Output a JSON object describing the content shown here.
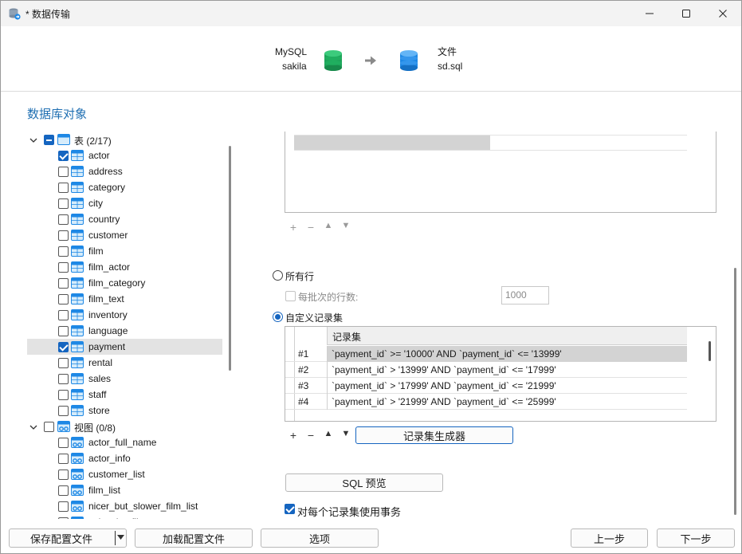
{
  "window": {
    "title": "* 数据传输",
    "controls": [
      "minimize-icon",
      "maximize-icon",
      "close-icon"
    ]
  },
  "header": {
    "source_type": "MySQL",
    "source_name": "sakila",
    "target_type": "文件",
    "target_name": "sd.sql"
  },
  "section_title": "数据库对象",
  "tree": {
    "tables_group": {
      "label": "表",
      "count": "(2/17)"
    },
    "tables": [
      {
        "label": "actor",
        "checked": true,
        "selected": false
      },
      {
        "label": "address",
        "checked": false,
        "selected": false
      },
      {
        "label": "category",
        "checked": false,
        "selected": false
      },
      {
        "label": "city",
        "checked": false,
        "selected": false
      },
      {
        "label": "country",
        "checked": false,
        "selected": false
      },
      {
        "label": "customer",
        "checked": false,
        "selected": false
      },
      {
        "label": "film",
        "checked": false,
        "selected": false
      },
      {
        "label": "film_actor",
        "checked": false,
        "selected": false
      },
      {
        "label": "film_category",
        "checked": false,
        "selected": false
      },
      {
        "label": "film_text",
        "checked": false,
        "selected": false
      },
      {
        "label": "inventory",
        "checked": false,
        "selected": false
      },
      {
        "label": "language",
        "checked": false,
        "selected": false
      },
      {
        "label": "payment",
        "checked": true,
        "selected": true
      },
      {
        "label": "rental",
        "checked": false,
        "selected": false
      },
      {
        "label": "sales",
        "checked": false,
        "selected": false
      },
      {
        "label": "staff",
        "checked": false,
        "selected": false
      },
      {
        "label": "store",
        "checked": false,
        "selected": false
      }
    ],
    "views_group": {
      "label": "视图",
      "count": "(0/8)"
    },
    "views": [
      {
        "label": "actor_full_name"
      },
      {
        "label": "actor_info"
      },
      {
        "label": "customer_list"
      },
      {
        "label": "film_list"
      },
      {
        "label": "nicer_but_slower_film_list"
      },
      {
        "label": "sales_by_film_cat"
      }
    ]
  },
  "options": {
    "all_rows_label": "所有行",
    "rows_per_batch_label": "每批次的行数:",
    "rows_per_batch_value": "1000",
    "custom_recordset_label": "自定义记录集",
    "recordset_header": "记录集",
    "recordsets": [
      {
        "num": "#1",
        "value": "`payment_id` >= '10000' AND `payment_id` <= '13999'"
      },
      {
        "num": "#2",
        "value": "`payment_id` > '13999' AND `payment_id` <= '17999'"
      },
      {
        "num": "#3",
        "value": "`payment_id` > '17999' AND `payment_id` <= '21999'"
      },
      {
        "num": "#4",
        "value": "`payment_id` > '21999' AND `payment_id` <= '25999'"
      }
    ],
    "generator_button": "记录集生成器",
    "sql_preview_button": "SQL 预览",
    "transaction_label": "对每个记录集使用事务"
  },
  "footer": {
    "save_profile": "保存配置文件",
    "load_profile": "加载配置文件",
    "options": "选项",
    "prev": "上一步",
    "next": "下一步"
  },
  "colors": {
    "accent": "#1565c0",
    "section_title": "#1f6fb2",
    "source_db": "#1fa35a",
    "target_file": "#1e88e5"
  }
}
